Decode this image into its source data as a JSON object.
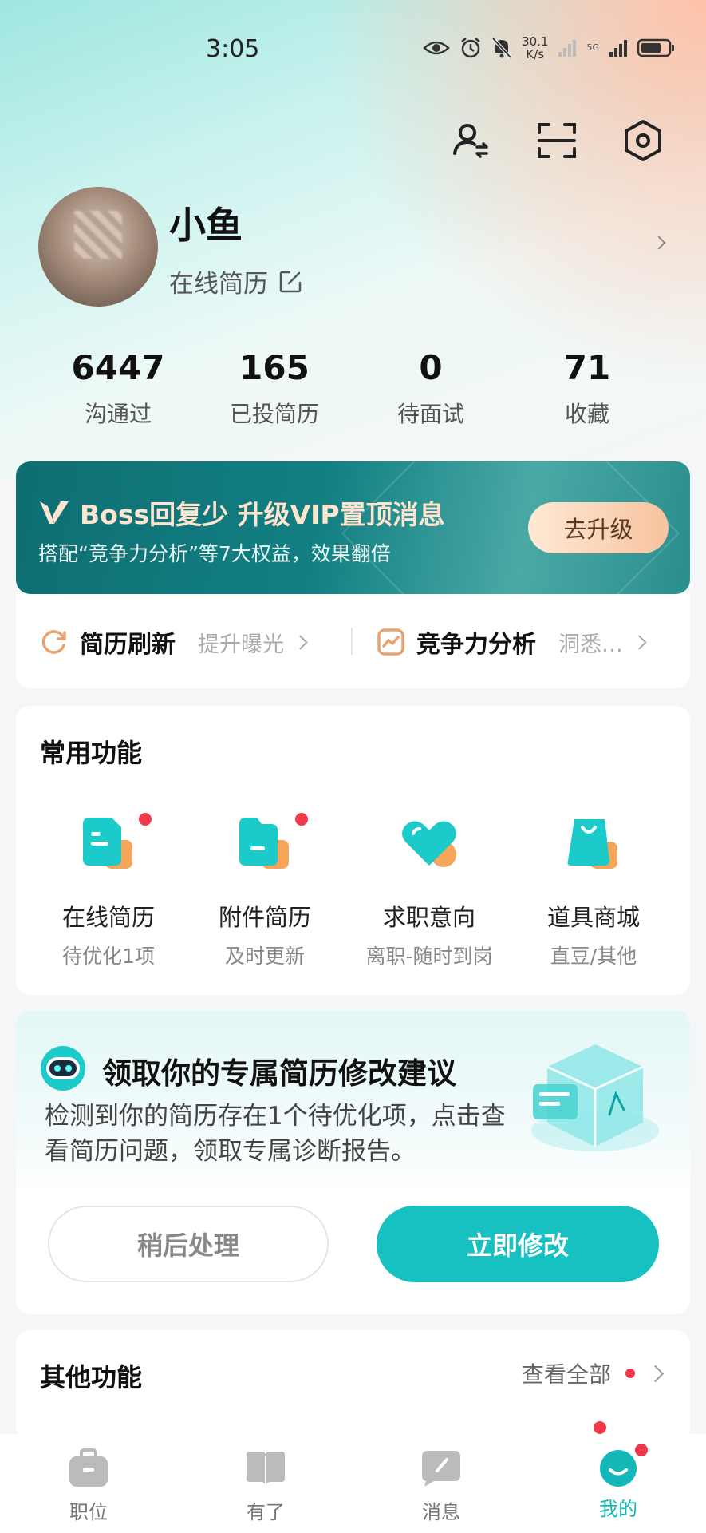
{
  "status_bar": {
    "time": "3:05",
    "speed_value": "30.1",
    "speed_unit": "K/s",
    "network": "5G"
  },
  "profile": {
    "name": "小鱼",
    "resume_link": "在线简历"
  },
  "stats": [
    {
      "value": "6447",
      "label": "沟通过"
    },
    {
      "value": "165",
      "label": "已投简历"
    },
    {
      "value": "0",
      "label": "待面试"
    },
    {
      "value": "71",
      "label": "收藏"
    }
  ],
  "vip_banner": {
    "title": "Boss回复少 升级VIP置顶消息",
    "subtitle": "搭配“竞争力分析”等7大权益，效果翻倍",
    "button": "去升级"
  },
  "quick_strip": {
    "refresh_title": "简历刷新",
    "refresh_sub": "提升曝光",
    "analysis_title": "竞争力分析",
    "analysis_sub": "洞悉…"
  },
  "common_functions": {
    "title": "常用功能",
    "items": [
      {
        "label": "在线简历",
        "sub": "待优化1项"
      },
      {
        "label": "附件简历",
        "sub": "及时更新"
      },
      {
        "label": "求职意向",
        "sub": "离职-随时到岗"
      },
      {
        "label": "道具商城",
        "sub": "直豆/其他"
      }
    ]
  },
  "advice": {
    "title": "领取你的专属简历修改建议",
    "description": "检测到你的简历存在1个待优化项，点击查看简历问题，领取专属诊断报告。",
    "later_button": "稍后处理",
    "now_button": "立即修改"
  },
  "other_functions": {
    "title": "其他功能",
    "view_all": "查看全部"
  },
  "bottom_nav": [
    {
      "label": "职位"
    },
    {
      "label": "有了"
    },
    {
      "label": "消息"
    },
    {
      "label": "我的"
    }
  ],
  "colors": {
    "accent": "#18c1c1",
    "vip_gold": "#fde5cf",
    "badge_red": "#f03a4b"
  }
}
